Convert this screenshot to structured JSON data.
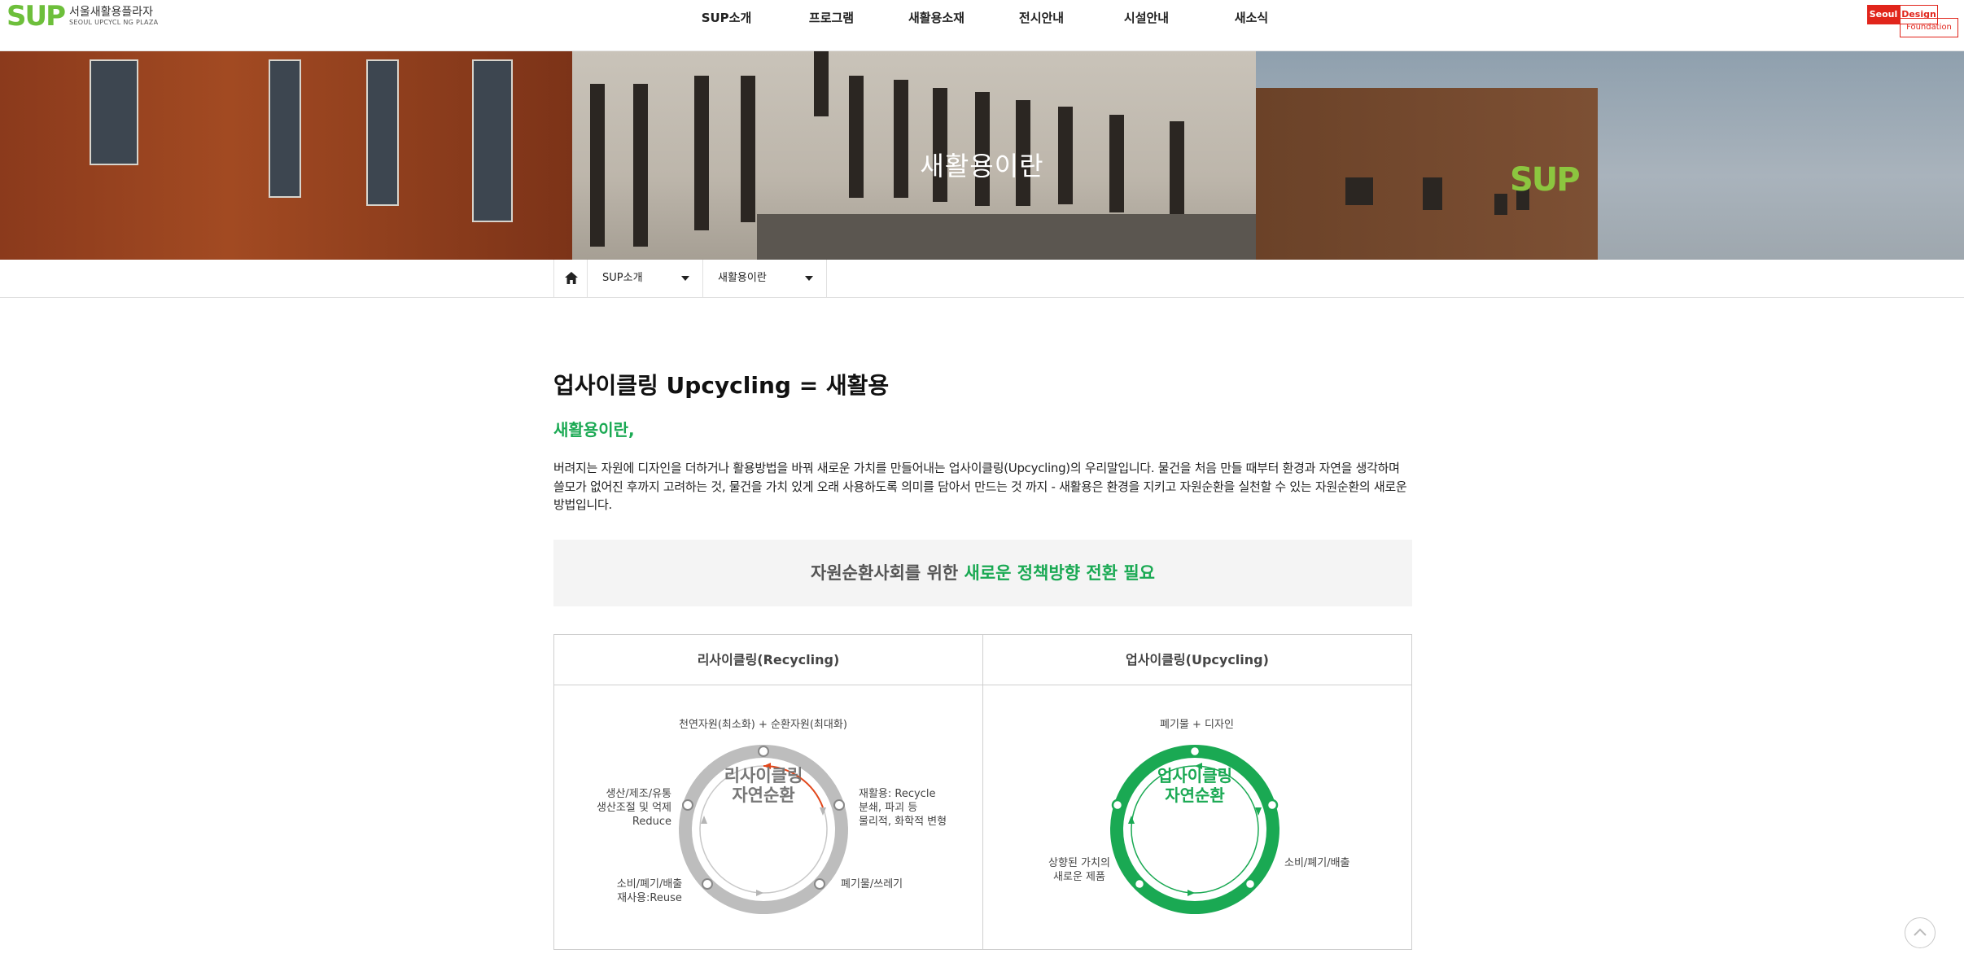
{
  "header": {
    "logo_mark": "SUP",
    "logo_ko": "서울새활용플라자",
    "logo_en": "SEOUL UPCYCL NG PLAZA",
    "nav": [
      "SUP소개",
      "프로그램",
      "새활용소재",
      "전시안내",
      "시설안내",
      "새소식"
    ],
    "partner": {
      "seoul": "Seoul",
      "design": "Design",
      "foundation": "Foundation"
    }
  },
  "hero": {
    "title": "새활용이란",
    "building_sign": "SUP"
  },
  "breadcrumb": {
    "home_icon": "home-icon",
    "depth1": "SUP소개",
    "depth2": "새활용이란"
  },
  "content": {
    "title": "업사이클링 Upcycling = 새활용",
    "subtitle": "새활용이란,",
    "paragraph": "버려지는 자원에 디자인을 더하거나 활용방법을 바꿔 새로운 가치를 만들어내는 업사이클링(Upcycling)의 우리말입니다. 물건을 처음 만들 때부터 환경과 자연을 생각하며 쓸모가 없어진 후까지 고려하는 것, 물건을 가치 있게 오래 사용하도록 의미를 담아서 만드는 것 까지 - 새활용은 환경을 지키고 자원순환을 실천할 수 있는 자원순환의 새로운 방법입니다.",
    "banner_prefix": "자원순환사회를 위한 ",
    "banner_emphasis": "새로운 정책방향 전환 필요"
  },
  "comparison": {
    "recycling": {
      "header": "리사이클링(Recycling)",
      "center_line1": "리사이클링",
      "center_line2": "자연순환",
      "top": "천연자원(최소화) + 순환자원(최대화)",
      "left_1": "생산/제조/유통",
      "left_2": "생산조절 및 억제",
      "left_3": "Reduce",
      "right_1": "재활용: Recycle",
      "right_2": "분쇄, 파괴 등",
      "right_3": "물리적, 화학적 변형",
      "bottom_left_1": "소비/폐기/배출",
      "bottom_left_2": "재사용:Reuse",
      "bottom_right": "폐기물/쓰레기",
      "ring_color": "#bdbdbd",
      "accent_color": "#e2471b"
    },
    "upcycling": {
      "header": "업사이클링(Upcycling)",
      "center_line1": "업사이클링",
      "center_line2": "자연순환",
      "top": "폐기물 + 디자인",
      "right": "소비/폐기/배출",
      "left_1": "상향된 가치의",
      "left_2": "새로운 제품",
      "ring_color": "#1aa953"
    }
  },
  "scroll_top_icon": "chevron-up-icon"
}
